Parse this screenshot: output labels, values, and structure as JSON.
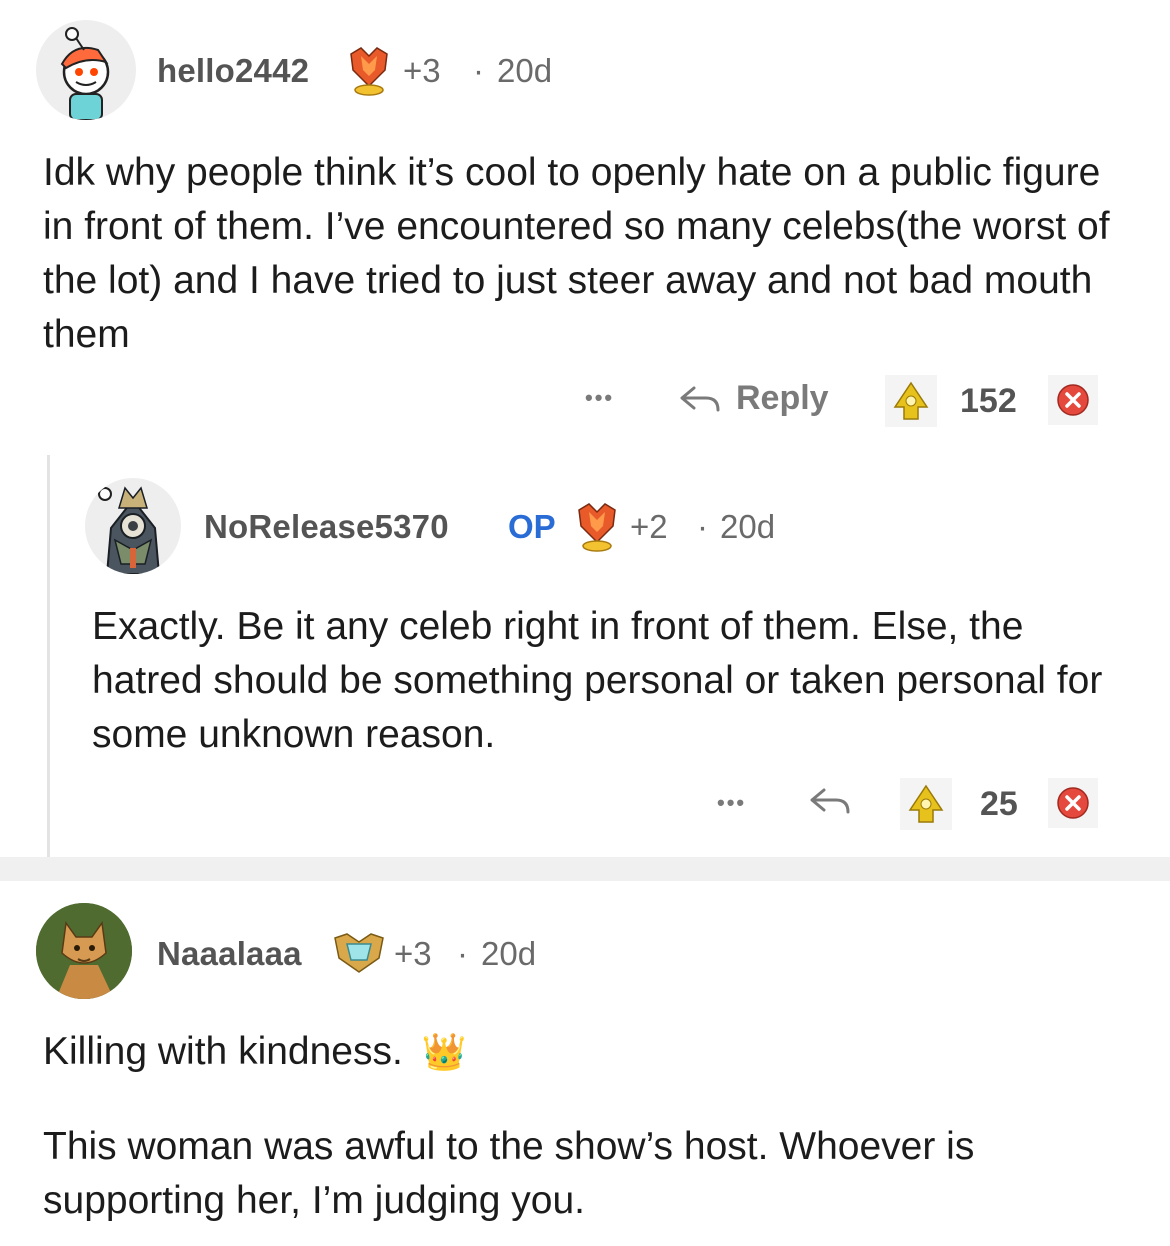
{
  "comments": [
    {
      "username": "hello2442",
      "is_op": false,
      "awards": "+3",
      "age": "20d",
      "text": "Idk why people think it’s cool to openly hate on a public figure in front of them. I’ve encountered so many celebs(the worst of the lot) and I have tried to just steer away and not bad mouth them",
      "more_label": "•••",
      "reply_label": "Reply",
      "votes": "152"
    },
    {
      "username": "NoRelease5370",
      "is_op": true,
      "op_label": "OP",
      "awards": "+2",
      "age": "20d",
      "text": "Exactly. Be it any celeb right in front of them. Else, the hatred should be something personal or taken personal for some unknown reason.",
      "more_label": "•••",
      "votes": "25"
    },
    {
      "username": "Naaalaaa",
      "is_op": false,
      "awards": "+3",
      "age": "20d",
      "text_line1": "Killing with kindness.",
      "emoji": "👑",
      "text_line2": "This woman was awful to the show’s host. Whoever is supporting her, I’m judging you."
    }
  ],
  "separator": "·",
  "icons": {
    "upvote": "upvote-icon",
    "downvote": "downvote-icon",
    "reply": "reply-arrow-icon",
    "more": "more-options-icon",
    "award": "award-badge-icon"
  },
  "colors": {
    "op": "#2a6cd6",
    "downvote": "#e5483c",
    "upvote": "#e8c21c",
    "text": "#1c1c1c",
    "meta": "#6a6a6a"
  }
}
